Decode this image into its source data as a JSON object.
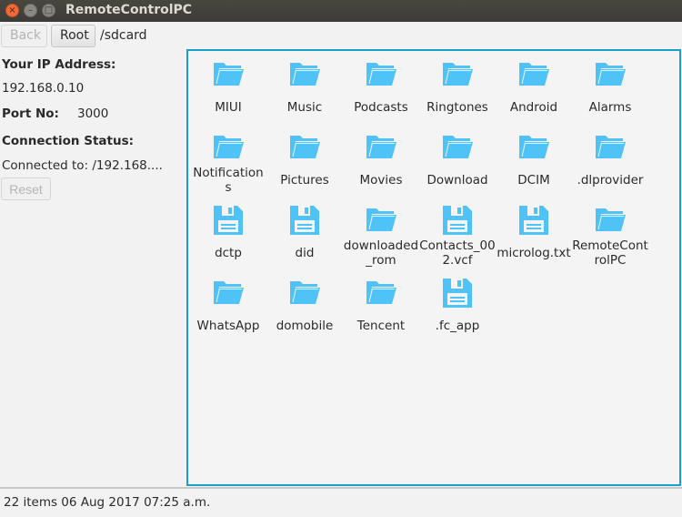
{
  "window": {
    "title": "RemoteControlPC",
    "controls": {
      "close": "×",
      "minimize": "–",
      "maximize": "□"
    }
  },
  "toolbar": {
    "back_label": "Back",
    "root_label": "Root",
    "current_path": "/sdcard"
  },
  "info": {
    "ip_label": "Your IP Address:",
    "ip_value": "192.168.0.10",
    "port_label": "Port No:",
    "port_value": "3000",
    "status_label": "Connection Status:",
    "status_value": "Connected to: /192.168....",
    "reset_label": "Reset"
  },
  "files": [
    {
      "name": "MIUI",
      "type": "folder"
    },
    {
      "name": "Music",
      "type": "folder"
    },
    {
      "name": "Podcasts",
      "type": "folder"
    },
    {
      "name": "Ringtones",
      "type": "folder"
    },
    {
      "name": "Android",
      "type": "folder"
    },
    {
      "name": "Alarms",
      "type": "folder"
    },
    {
      "name": "Notifications",
      "type": "folder"
    },
    {
      "name": "Pictures",
      "type": "folder"
    },
    {
      "name": "Movies",
      "type": "folder"
    },
    {
      "name": "Download",
      "type": "folder"
    },
    {
      "name": "DCIM",
      "type": "folder"
    },
    {
      "name": ".dlprovider",
      "type": "folder"
    },
    {
      "name": "dctp",
      "type": "file"
    },
    {
      "name": "did",
      "type": "file"
    },
    {
      "name": "downloaded_rom",
      "type": "folder"
    },
    {
      "name": "Contacts_002.vcf",
      "type": "file"
    },
    {
      "name": "microlog.txt",
      "type": "file"
    },
    {
      "name": "RemoteControlPC",
      "type": "folder"
    },
    {
      "name": "WhatsApp",
      "type": "folder"
    },
    {
      "name": "domobile",
      "type": "folder"
    },
    {
      "name": "Tencent",
      "type": "folder"
    },
    {
      "name": ".fc_app",
      "type": "file"
    }
  ],
  "statusbar": {
    "text": "22 items 06 Aug 2017 07:25 a.m."
  },
  "colors": {
    "accent": "#1aa0cf",
    "icon": "#4fc3f7"
  }
}
